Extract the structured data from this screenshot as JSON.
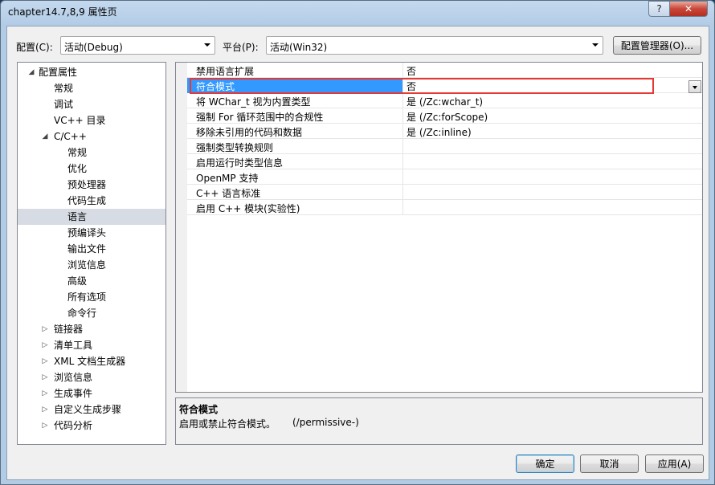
{
  "window": {
    "title": "chapter14.7,8,9 属性页",
    "help_glyph": "?",
    "close_glyph": "✕"
  },
  "toolbar": {
    "config_label": "配置(C):",
    "config_value": "活动(Debug)",
    "platform_label": "平台(P):",
    "platform_value": "活动(Win32)",
    "config_manager_label": "配置管理器(O)..."
  },
  "tree": {
    "items": [
      {
        "label": "配置属性",
        "expander": "◢"
      },
      {
        "label": "常规"
      },
      {
        "label": "调试"
      },
      {
        "label": "VC++ 目录"
      },
      {
        "label": "C/C++",
        "expander": "◢"
      },
      {
        "label": "常规"
      },
      {
        "label": "优化"
      },
      {
        "label": "预处理器"
      },
      {
        "label": "代码生成"
      },
      {
        "label": "语言"
      },
      {
        "label": "预编译头"
      },
      {
        "label": "输出文件"
      },
      {
        "label": "浏览信息"
      },
      {
        "label": "高级"
      },
      {
        "label": "所有选项"
      },
      {
        "label": "命令行"
      },
      {
        "label": "链接器",
        "expander": "▷"
      },
      {
        "label": "清单工具",
        "expander": "▷"
      },
      {
        "label": "XML 文档生成器",
        "expander": "▷"
      },
      {
        "label": "浏览信息",
        "expander": "▷"
      },
      {
        "label": "生成事件",
        "expander": "▷"
      },
      {
        "label": "自定义生成步骤",
        "expander": "▷"
      },
      {
        "label": "代码分析",
        "expander": "▷"
      }
    ]
  },
  "properties": {
    "rows": [
      {
        "name": "禁用语言扩展",
        "value": "否"
      },
      {
        "name": "符合模式",
        "value": "否"
      },
      {
        "name": "将 WChar_t 视为内置类型",
        "value": "是 (/Zc:wchar_t)"
      },
      {
        "name": "强制 For 循环范围中的合规性",
        "value": "是 (/Zc:forScope)"
      },
      {
        "name": "移除未引用的代码和数据",
        "value": "是 (/Zc:inline)"
      },
      {
        "name": "强制类型转换规则",
        "value": ""
      },
      {
        "name": "启用运行时类型信息",
        "value": ""
      },
      {
        "name": "OpenMP 支持",
        "value": ""
      },
      {
        "name": "C++ 语言标准",
        "value": ""
      },
      {
        "name": "启用 C++ 模块(实验性)",
        "value": ""
      }
    ]
  },
  "description": {
    "title": "符合模式",
    "text": "启用或禁止符合模式。",
    "option": "(/permissive-)"
  },
  "buttons": {
    "ok": "确定",
    "cancel": "取消",
    "apply": "应用(A)"
  },
  "colors": {
    "selection": "#3399ff",
    "highlight_box": "#e53935",
    "tree_selection": "#d6dbe4"
  }
}
